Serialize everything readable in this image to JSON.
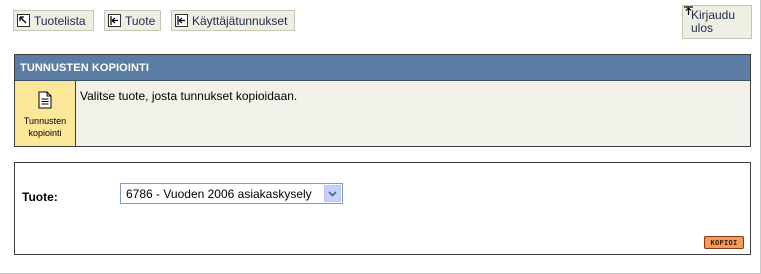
{
  "nav": {
    "tuotelista": "Tuotelista",
    "tuote": "Tuote",
    "kayttajatunnukset": "Käyttäjätunnukset",
    "logout_line1": "Kirjaudu",
    "logout_line2": "ulos"
  },
  "panel": {
    "title": "TUNNUSTEN KOPIOINTI",
    "side_label_1": "Tunnusten",
    "side_label_2": "kopiointi",
    "instruction": "Valitse tuote, josta tunnukset kopioidaan."
  },
  "form": {
    "product_label": "Tuote:",
    "product_selected": "6786 - Vuoden 2006 asiakaskysely",
    "copy_button": "KOPIOI"
  },
  "colors": {
    "header_bg": "#5b7ca3",
    "side_box_bg": "#fde89a",
    "copy_button_bg": "#f59a5a"
  }
}
